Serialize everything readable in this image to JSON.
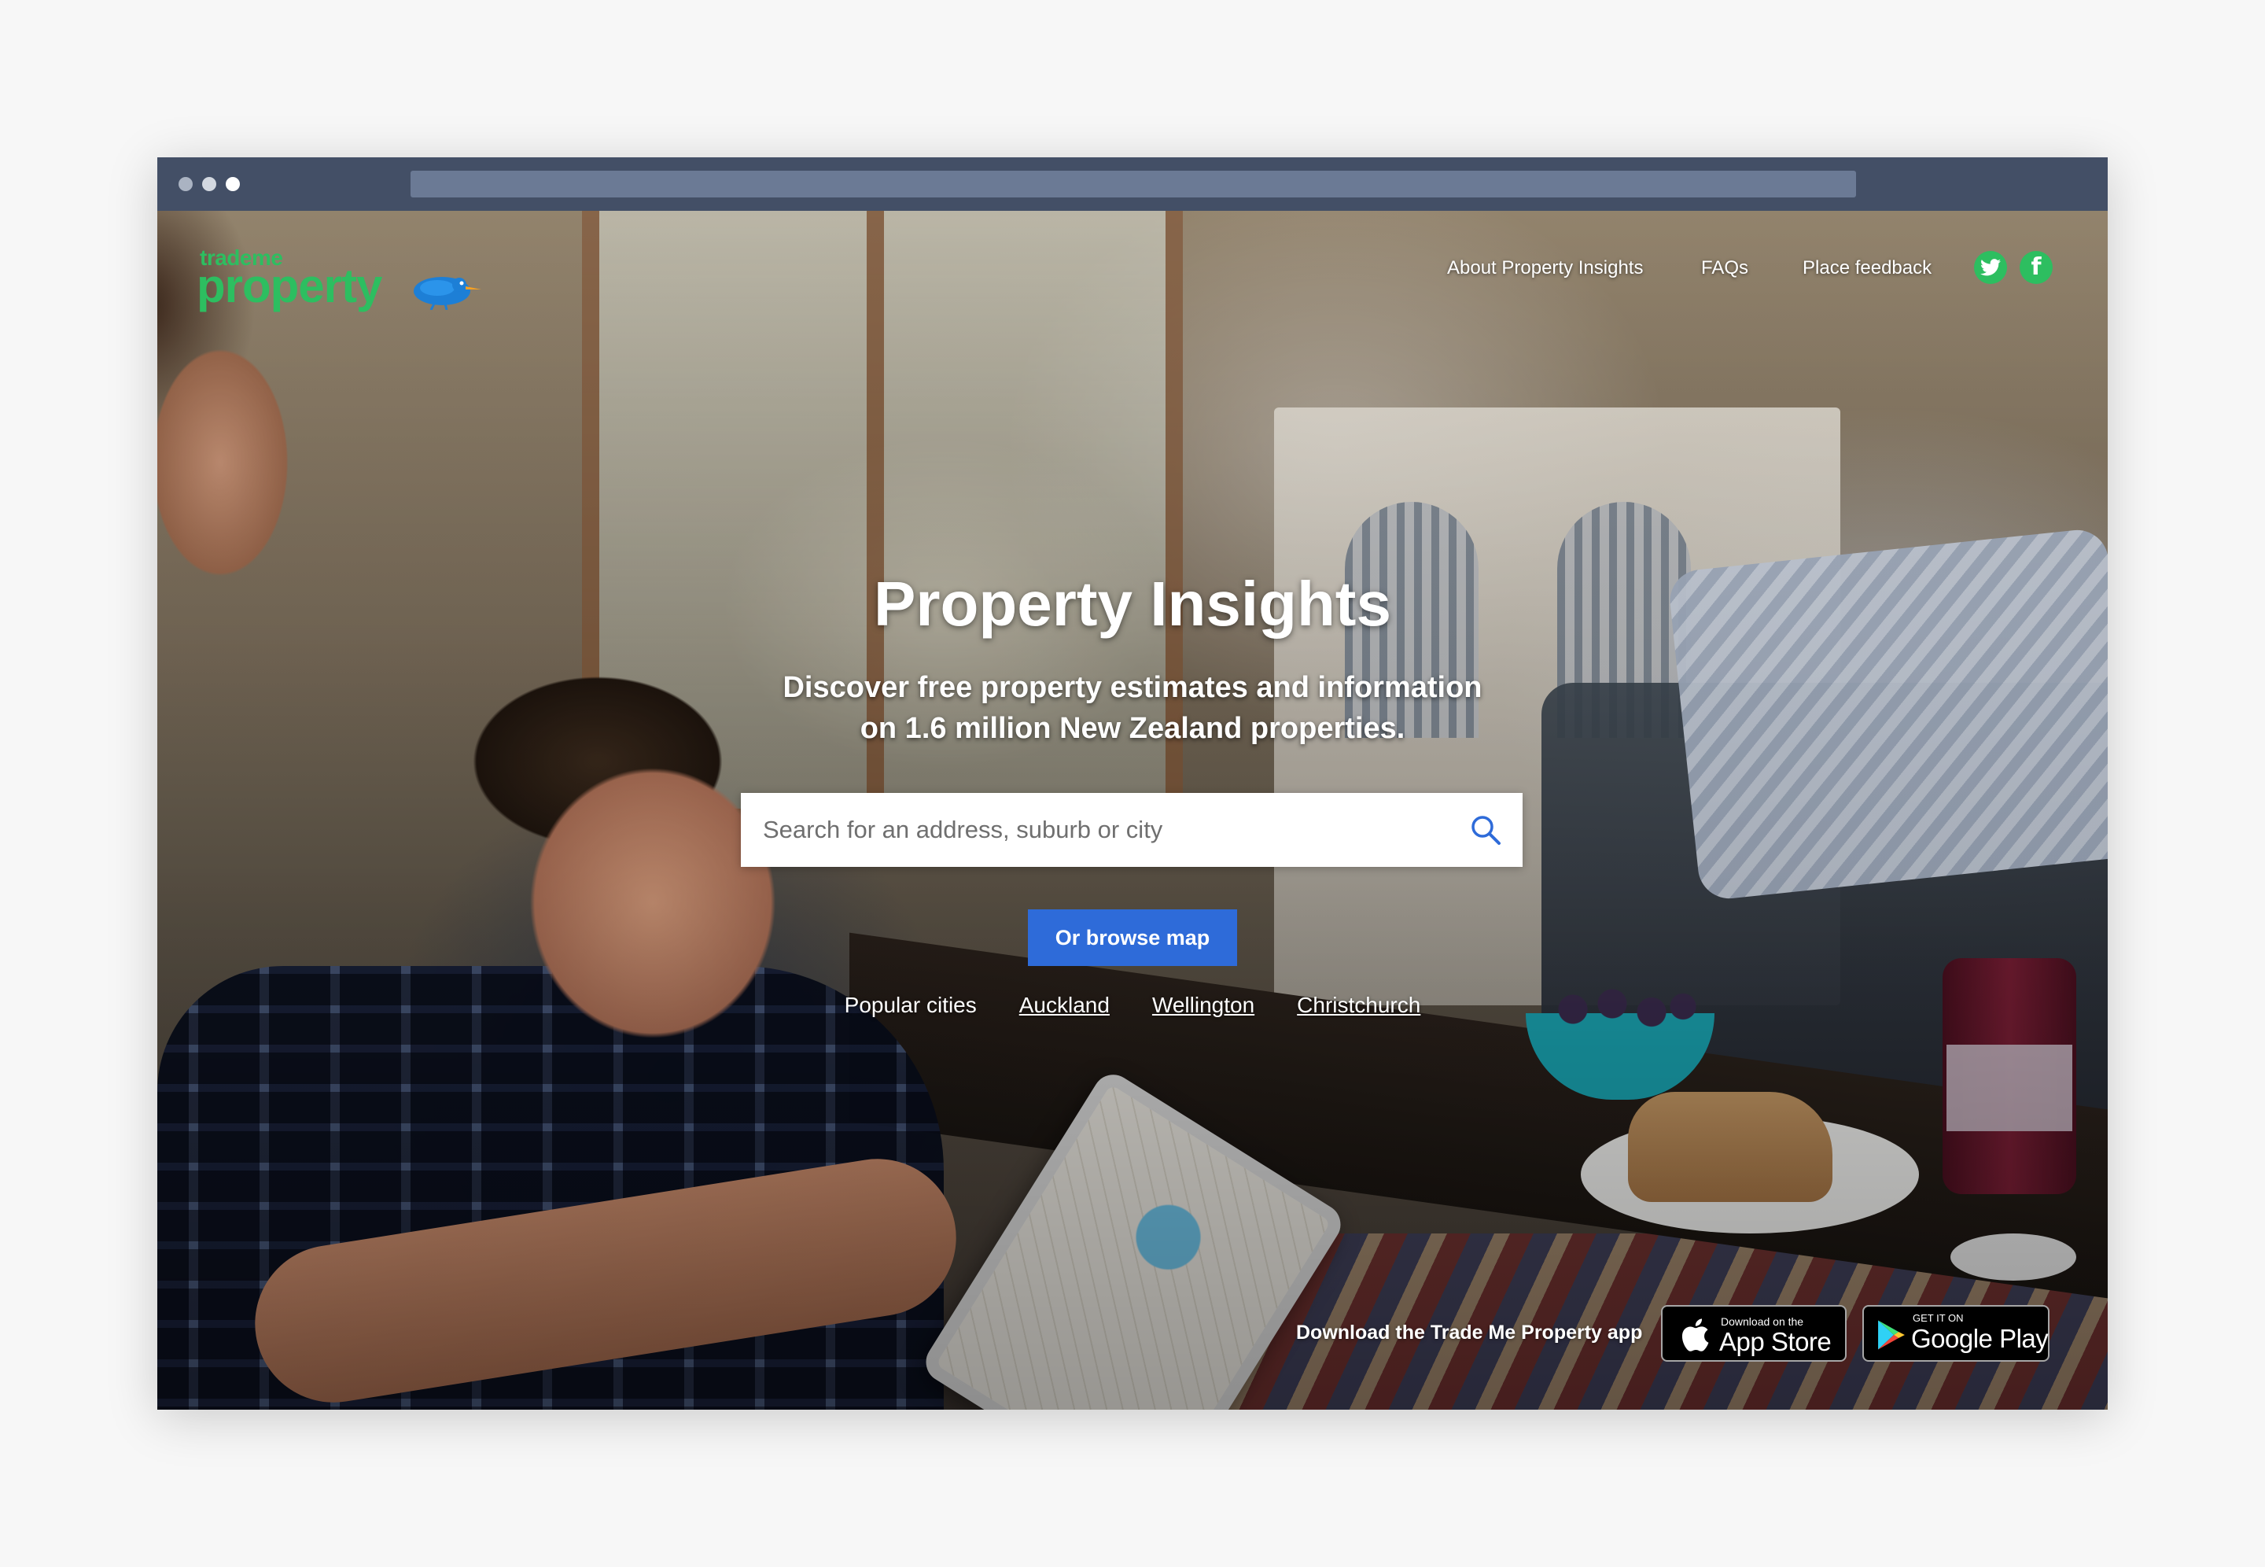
{
  "brand": {
    "logo_small": "trademe",
    "logo_big": "property",
    "accent_color": "#2dbe60",
    "button_color": "#2e6bd9"
  },
  "nav": {
    "about": "About Property Insights",
    "faqs": "FAQs",
    "feedback": "Place feedback",
    "social_icons": [
      "twitter-icon",
      "facebook-icon"
    ]
  },
  "hero": {
    "title": "Property Insights",
    "subtitle_line1": "Discover free property estimates and information",
    "subtitle_line2": "on 1.6 million New Zealand properties."
  },
  "search": {
    "placeholder": "Search for an address, suburb or city",
    "value": "",
    "icon": "search-icon"
  },
  "browse_map": "Or browse map",
  "popular": {
    "label": "Popular cities",
    "cities": [
      "Auckland",
      "Wellington",
      "Christchurch"
    ]
  },
  "app": {
    "text": "Download the Trade Me Property app",
    "apple_small": "Download on the",
    "apple_big": "App Store",
    "google_small": "GET IT ON",
    "google_big": "Google Play"
  }
}
